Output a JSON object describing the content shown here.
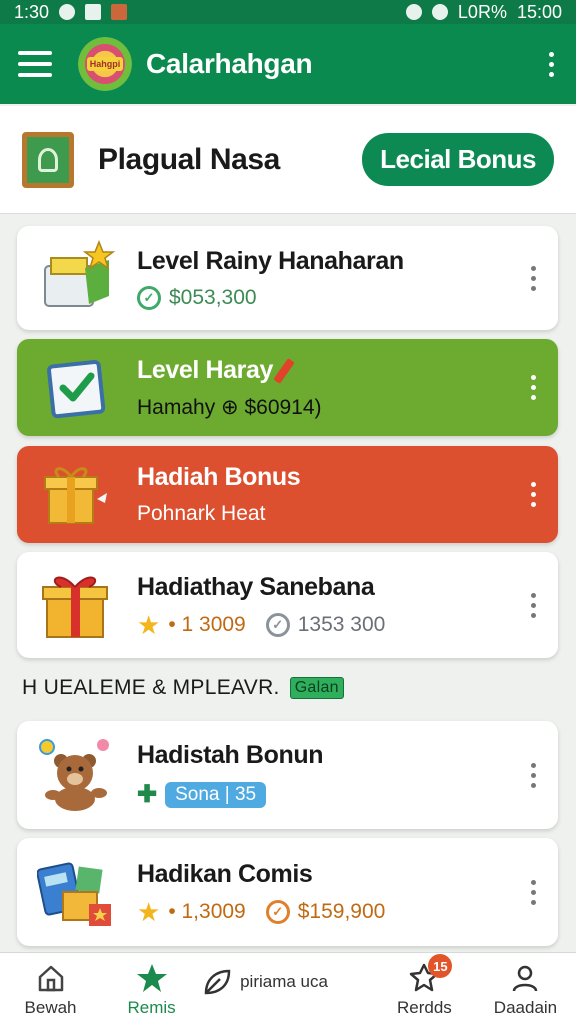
{
  "status_bar": {
    "time_left": "1:30",
    "battery_text": "L0R%",
    "time_right": "15:00"
  },
  "app_bar": {
    "logo_text": "Hahgpi",
    "title": "Calarhahgan"
  },
  "header": {
    "title": "Plagual Nasa",
    "button_label": "Lecial Bonus"
  },
  "cards": [
    {
      "title": "Level Rainy Hanaharan",
      "amount": "$053,300",
      "style": "white"
    },
    {
      "title": "Level Haray",
      "subtitle": "Hamahy ⊕ $60914)",
      "style": "green"
    },
    {
      "title": "Hadiah Bonus",
      "subtitle": "Pohnark Heat",
      "style": "red"
    },
    {
      "title": "Hadiathay Sanebana",
      "stars": "• 1 3009",
      "amount": "1353 300",
      "style": "white"
    }
  ],
  "section": {
    "label": "H UEALEME & MPLEAVR.",
    "tag": "Galan"
  },
  "cards2": [
    {
      "title": "Hadistah Bonun",
      "chip": "Sona | 35"
    },
    {
      "title": "Hadikan Comis",
      "stars": "• 1,3009",
      "amount": "$159,900"
    }
  ],
  "bottom_nav": {
    "items": [
      {
        "label": "Bewah",
        "icon": "home-icon"
      },
      {
        "label": "Remis",
        "icon": "star-icon",
        "active": true
      },
      {
        "label": "piriama uca",
        "icon": "leaf-icon"
      },
      {
        "label": "Rerdds",
        "icon": "badge-icon",
        "badge": "15"
      },
      {
        "label": "Daadain",
        "icon": "profile-icon"
      }
    ]
  },
  "colors": {
    "primary": "#0b8a4f",
    "green_card": "#6cab2f",
    "red_card": "#dc5030",
    "chip": "#4eaae0"
  }
}
